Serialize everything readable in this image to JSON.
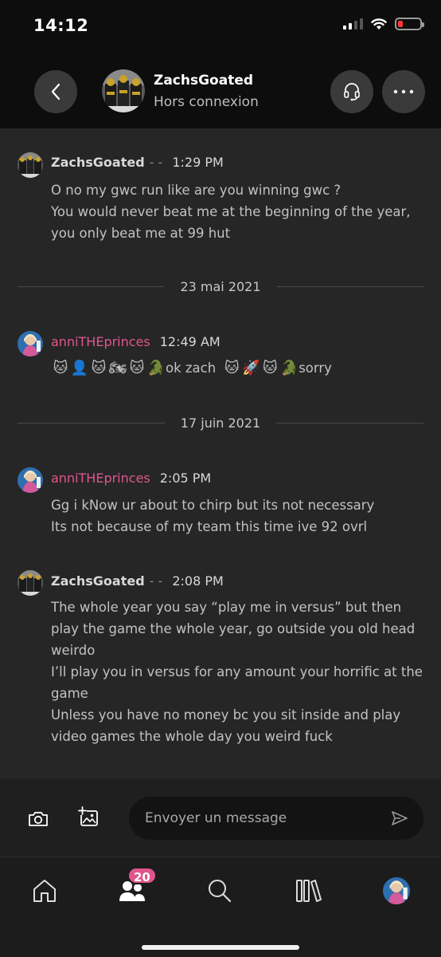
{
  "status_bar": {
    "time": "14:12",
    "icons": [
      "cellular-signal-icon",
      "wifi-icon",
      "battery-low-icon"
    ],
    "battery_color": "#ff3b30"
  },
  "header": {
    "contact_name": "ZachsGoated",
    "contact_status": "Hors connexion",
    "icons": [
      "back-chevron-icon",
      "headset-icon",
      "more-dots-icon"
    ]
  },
  "messages": [
    {
      "author": "ZachsGoated",
      "dashes": "- -",
      "time": "1:29 PM",
      "lines": [
        "O no my gwc run like are you winning gwc ?",
        "You would never beat me at the beginning of the year,",
        "you only beat me at 99 hut"
      ]
    },
    {
      "author": "anniTHEprinces",
      "time": "12:49 AM",
      "emoji_text": [
        "ok zach",
        "sorry"
      ],
      "emoji_icons": [
        "cat-face-icon",
        "person-silhouette-icon",
        "cat-face-icon",
        "motorcycle-icon",
        "cat-face-icon",
        "crocodile-icon",
        "cat-face-icon",
        "rocket-icon",
        "cat-face-icon",
        "crocodile-icon"
      ]
    },
    {
      "author": "anniTHEprinces",
      "time": "2:05 PM",
      "lines": [
        "Gg i kNow ur about to chirp but its not necessary",
        "Its not because of my team this time ive 92 ovrl"
      ]
    },
    {
      "author": "ZachsGoated",
      "dashes": "- -",
      "time": "2:08 PM",
      "lines": [
        "The whole year you say “play me in versus” but then",
        "play the game the whole year, go outside you old head",
        "weirdo",
        "I’ll play you in versus for any amount your horrific at the",
        "game",
        "Unless you have no money bc you sit inside and play",
        "video games the whole day you weird fuck"
      ]
    }
  ],
  "date_dividers": [
    "23 mai 2021",
    "17 juin 2021"
  ],
  "composer": {
    "placeholder": "Envoyer un message",
    "icons": [
      "camera-icon",
      "add-image-icon",
      "send-icon"
    ]
  },
  "bottom_nav": {
    "items": [
      "home",
      "friends",
      "search",
      "library",
      "profile"
    ],
    "badge_count": "20",
    "accent_color": "#e0568c"
  }
}
